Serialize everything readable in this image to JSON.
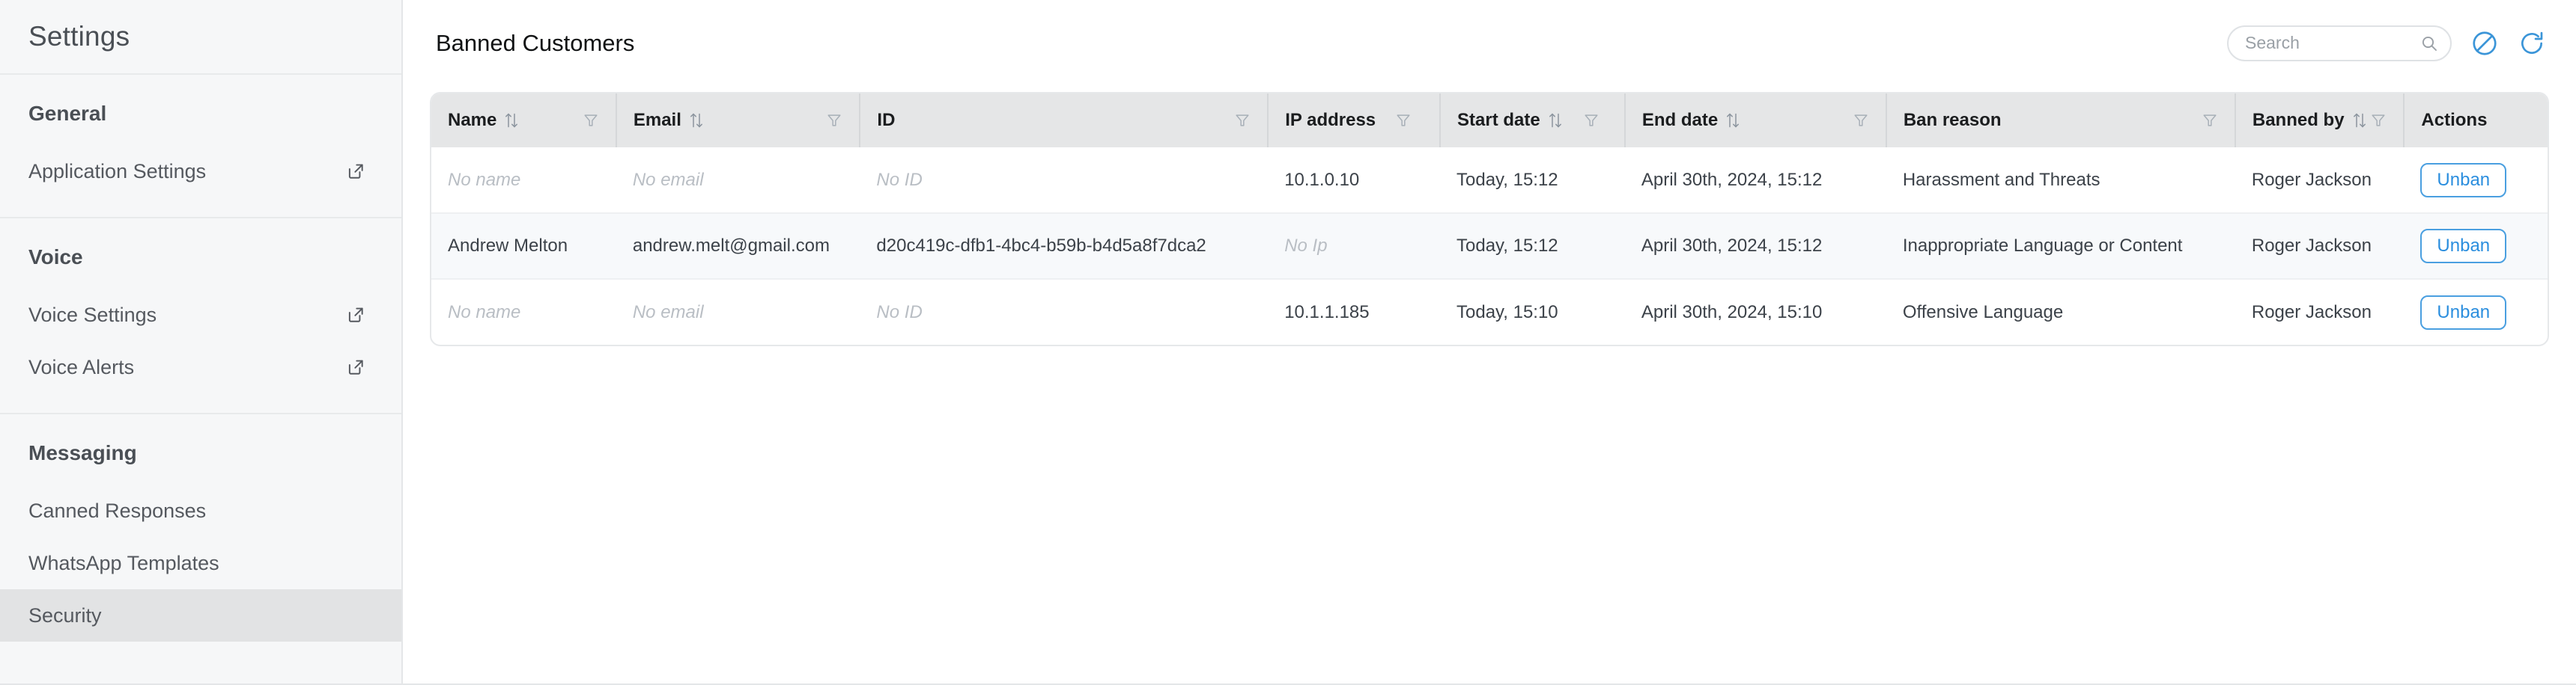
{
  "sidebar": {
    "title": "Settings",
    "groups": [
      {
        "label": "General",
        "items": [
          {
            "label": "Application Settings",
            "external": true,
            "active": false
          }
        ]
      },
      {
        "label": "Voice",
        "items": [
          {
            "label": "Voice Settings",
            "external": true,
            "active": false
          },
          {
            "label": "Voice Alerts",
            "external": true,
            "active": false
          }
        ]
      },
      {
        "label": "Messaging",
        "items": [
          {
            "label": "Canned Responses",
            "external": false,
            "active": false
          },
          {
            "label": "WhatsApp Templates",
            "external": false,
            "active": false
          },
          {
            "label": "Security",
            "external": false,
            "active": true
          }
        ]
      }
    ]
  },
  "header": {
    "title": "Banned Customers",
    "search": {
      "placeholder": "Search",
      "value": "",
      "icon": "search-icon"
    },
    "actions": [
      {
        "name": "ban-customer-icon",
        "tooltip": "Ban customer",
        "color": "#3b95d8"
      },
      {
        "name": "refresh-icon",
        "tooltip": "Refresh",
        "color": "#3b95d8"
      }
    ]
  },
  "table": {
    "columns": [
      {
        "key": "name",
        "label": "Name",
        "sortable": true,
        "filterable": true,
        "cls": "c-name"
      },
      {
        "key": "email",
        "label": "Email",
        "sortable": true,
        "filterable": true,
        "cls": "c-email"
      },
      {
        "key": "id",
        "label": "ID",
        "sortable": false,
        "filterable": true,
        "cls": "c-id"
      },
      {
        "key": "ip",
        "label": "IP address",
        "sortable": false,
        "filterable": true,
        "cls": "c-ip"
      },
      {
        "key": "start",
        "label": "Start date",
        "sortable": true,
        "filterable": true,
        "cls": "c-start"
      },
      {
        "key": "end",
        "label": "End date",
        "sortable": true,
        "filterable": true,
        "cls": "c-end"
      },
      {
        "key": "reason",
        "label": "Ban reason",
        "sortable": false,
        "filterable": true,
        "cls": "c-reason"
      },
      {
        "key": "by",
        "label": "Banned by",
        "sortable": true,
        "filterable": true,
        "cls": "c-by"
      },
      {
        "key": "act",
        "label": "Actions",
        "sortable": false,
        "filterable": false,
        "cls": "c-act"
      }
    ],
    "rows": [
      {
        "name": "No name",
        "name_empty": true,
        "email": "No email",
        "email_empty": true,
        "id": "No ID",
        "id_empty": true,
        "ip": "10.1.0.10",
        "ip_empty": false,
        "start": "Today, 15:12",
        "end": "April 30th, 2024, 15:12",
        "reason": "Harassment and Threats",
        "by": "Roger Jackson",
        "action_label": "Unban",
        "stripe": false
      },
      {
        "name": "Andrew Melton",
        "name_empty": false,
        "email": "andrew.melt@gmail.com",
        "email_empty": false,
        "id": "d20c419c-dfb1-4bc4-b59b-b4d5a8f7dca2",
        "id_empty": false,
        "ip": "No Ip",
        "ip_empty": true,
        "start": "Today, 15:12",
        "end": "April 30th, 2024, 15:12",
        "reason": "Inappropriate Language or Content",
        "by": "Roger Jackson",
        "action_label": "Unban",
        "stripe": true
      },
      {
        "name": "No name",
        "name_empty": true,
        "email": "No email",
        "email_empty": true,
        "id": "No ID",
        "id_empty": true,
        "ip": "10.1.1.185",
        "ip_empty": false,
        "start": "Today, 15:10",
        "end": "April 30th, 2024, 15:10",
        "reason": "Offensive Language",
        "by": "Roger Jackson",
        "action_label": "Unban",
        "stripe": false
      }
    ]
  },
  "colors": {
    "accent": "#3b95d8",
    "sidebar_bg": "#f6f7f8",
    "active_item_bg": "#e2e3e4",
    "table_header_bg": "#e5e6e7",
    "stripe_bg": "#f7f9fb",
    "muted_text": "#b9bec4"
  }
}
